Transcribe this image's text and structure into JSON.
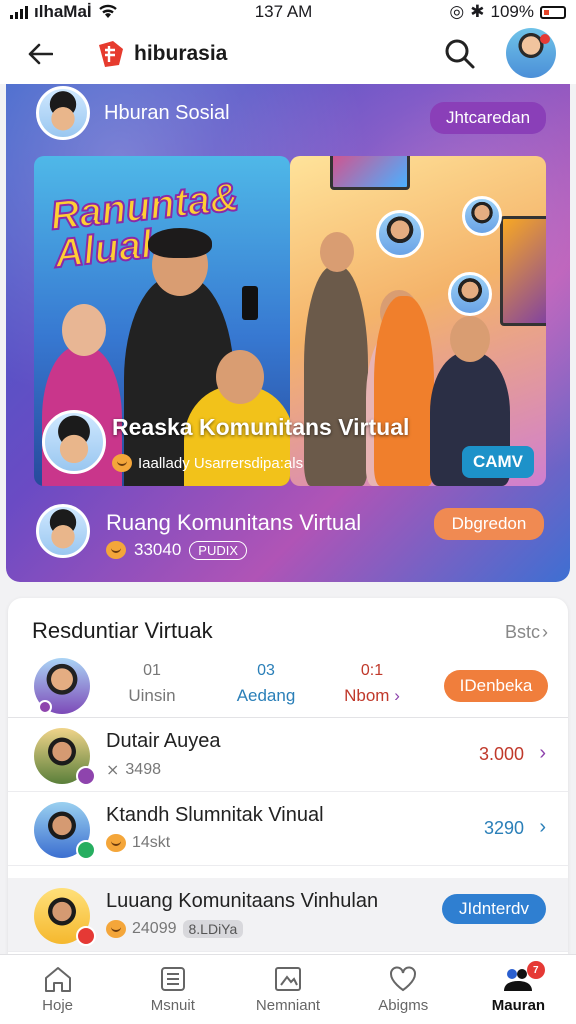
{
  "status_bar": {
    "carrier": "ılhaMaİ",
    "time": "137 AM",
    "battery": "109%"
  },
  "header": {
    "brand": "hiburasia",
    "icons": [
      "back-arrow-icon",
      "search-icon",
      "user-avatar"
    ]
  },
  "hero": {
    "top_title": "Hburan Sosial",
    "top_pill": "Jhtcaredan",
    "banner_text": "Ranunta& Aluals",
    "mid_title": "Reaska Komunitans Virtual",
    "mid_sub": "Iaallady Usarrersdipa:als",
    "mid_pill": "CAMV",
    "bottom_title": "Ruang Komunitans Virtual",
    "bottom_count": "33040",
    "bottom_tag": "PUDIX",
    "bottom_pill": "Dbgredon"
  },
  "list": {
    "title": "Resduntiar Virtuak",
    "see_more": "Bstc",
    "stats": [
      {
        "num": "01",
        "label": "Uinsin",
        "color": "#777777"
      },
      {
        "num": "03",
        "label": "Aedang",
        "color": "#2a7fb8"
      },
      {
        "num": "0:1",
        "label": "Nbom",
        "color": "#c0392b"
      }
    ],
    "stats_pill": "IDenbeka",
    "rows": [
      {
        "title": "Dutair Auyea",
        "meta": "3498",
        "value": "3.000",
        "value_color": "#c0392b"
      },
      {
        "title": "Ktandh Slumnitak Vinual",
        "meta": "14skt",
        "value": "3290",
        "value_color": "#2a7fb8"
      },
      {
        "title": "Luuang Komunitaans Vinhulan",
        "meta": "24099",
        "tag": "8.LDiYa",
        "pill": "JIdnterdv"
      }
    ]
  },
  "bottom_nav": [
    {
      "label": "Hoje",
      "icon": "home-icon"
    },
    {
      "label": "Msnuit",
      "icon": "grid-icon"
    },
    {
      "label": "Nemniant",
      "icon": "image-frame-icon"
    },
    {
      "label": "Abigms",
      "icon": "heart-icon"
    },
    {
      "label": "Mauran",
      "icon": "profile-icon",
      "badge": "7"
    }
  ]
}
